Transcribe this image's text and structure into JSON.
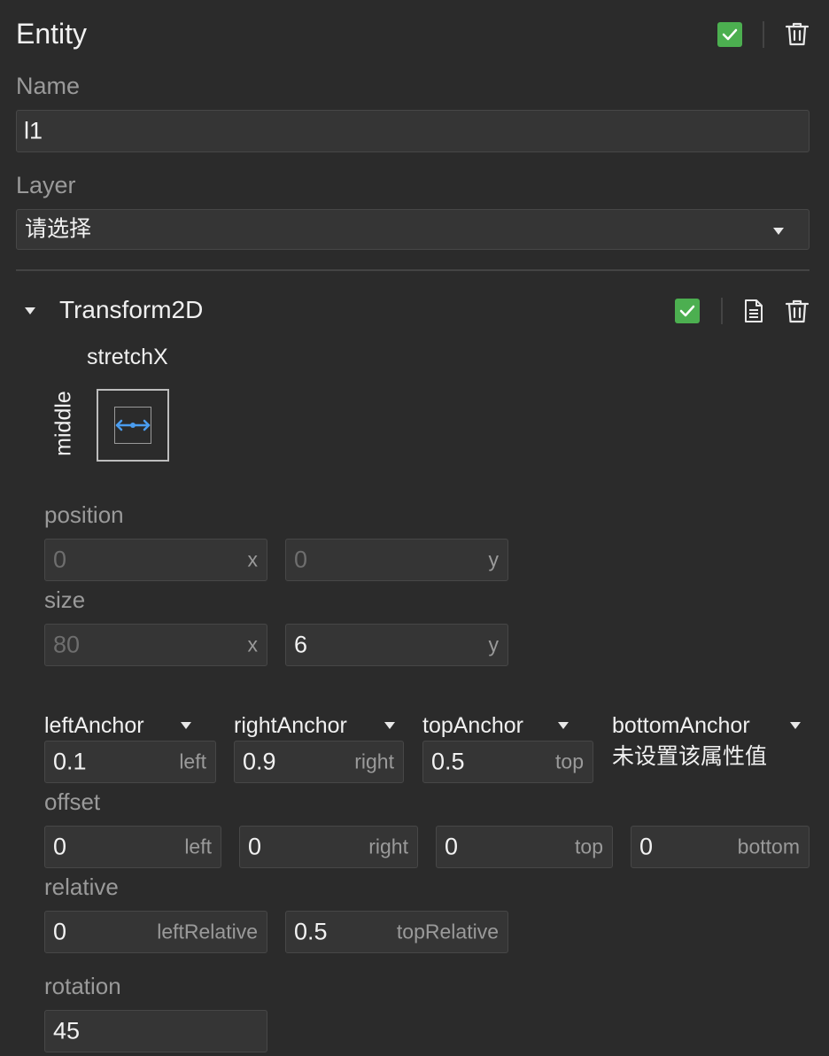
{
  "entity": {
    "title": "Entity",
    "name_label": "Name",
    "name_value": "l1",
    "layer_label": "Layer",
    "layer_value": "请选择",
    "enabled": true
  },
  "transform": {
    "title": "Transform2D",
    "enabled": true,
    "stretch_label": "stretchX",
    "vertical_label": "middle",
    "position": {
      "label": "position",
      "x_value": "0",
      "x_suffix": "x",
      "y_value": "0",
      "y_suffix": "y"
    },
    "size": {
      "label": "size",
      "x_value": "80",
      "x_suffix": "x",
      "y_value": "6",
      "y_suffix": "y"
    },
    "anchors": {
      "left": {
        "label": "leftAnchor",
        "value": "0.1",
        "suffix": "left"
      },
      "right": {
        "label": "rightAnchor",
        "value": "0.9",
        "suffix": "right"
      },
      "top": {
        "label": "topAnchor",
        "value": "0.5",
        "suffix": "top"
      },
      "bottom": {
        "label": "bottomAnchor",
        "unset_text": "未设置该属性值"
      }
    },
    "offset": {
      "label": "offset",
      "left": {
        "value": "0",
        "suffix": "left"
      },
      "right": {
        "value": "0",
        "suffix": "right"
      },
      "top": {
        "value": "0",
        "suffix": "top"
      },
      "bottom": {
        "value": "0",
        "suffix": "bottom"
      }
    },
    "relative": {
      "label": "relative",
      "left": {
        "value": "0",
        "suffix": "leftRelative"
      },
      "top": {
        "value": "0.5",
        "suffix": "topRelative"
      }
    },
    "rotation": {
      "label": "rotation",
      "value": "45"
    }
  },
  "colors": {
    "background": "#2b2b2b",
    "field": "#353535",
    "check": "#4caf50",
    "accent_blue": "#4a9df0"
  },
  "icons": [
    "checkbox-checked-icon",
    "trash-icon",
    "file-icon",
    "caret-down-icon",
    "stretch-x-icon"
  ]
}
